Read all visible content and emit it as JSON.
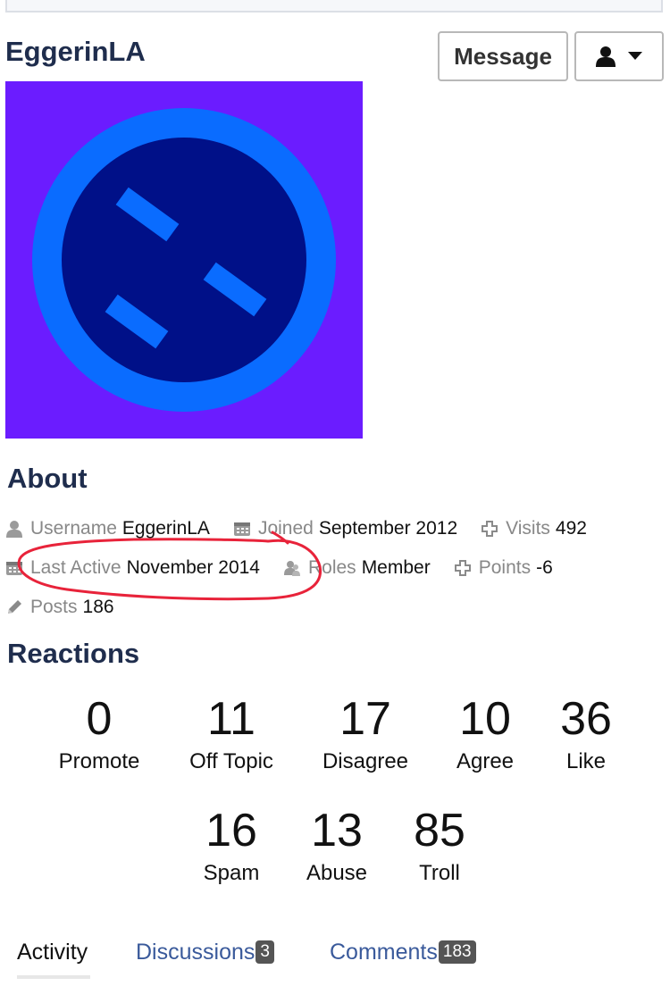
{
  "profile": {
    "name": "EggerinLA",
    "message_button": "Message"
  },
  "avatar": {
    "background_color": "#6b1cff",
    "ring_color": "#0a6cff",
    "face_color": "#001088"
  },
  "about": {
    "title": "About",
    "rows": [
      [
        {
          "icon": "user-icon",
          "label": "Username",
          "value": "EggerinLA"
        },
        {
          "icon": "calendar-icon",
          "label": "Joined",
          "value": "September 2012"
        },
        {
          "icon": "plus-icon",
          "label": "Visits",
          "value": "492"
        }
      ],
      [
        {
          "icon": "calendar-icon",
          "label": "Last Active",
          "value": "November 2014"
        },
        {
          "icon": "roles-icon",
          "label": "Roles",
          "value": "Member"
        },
        {
          "icon": "plus-icon",
          "label": "Points",
          "value": "-6"
        }
      ],
      [
        {
          "icon": "pencil-icon",
          "label": "Posts",
          "value": "186"
        }
      ]
    ]
  },
  "reactions": {
    "title": "Reactions",
    "items": [
      {
        "count": "0",
        "label": "Promote"
      },
      {
        "count": "11",
        "label": "Off Topic"
      },
      {
        "count": "17",
        "label": "Disagree"
      },
      {
        "count": "10",
        "label": "Agree"
      },
      {
        "count": "36",
        "label": "Like"
      },
      {
        "count": "16",
        "label": "Spam"
      },
      {
        "count": "13",
        "label": "Abuse"
      },
      {
        "count": "85",
        "label": "Troll"
      }
    ]
  },
  "tabs": [
    {
      "label": "Activity",
      "badge": null,
      "active": true
    },
    {
      "label": "Discussions",
      "badge": "3",
      "active": false
    },
    {
      "label": "Comments",
      "badge": "183",
      "active": false
    }
  ],
  "annotation_color": "#e8233a"
}
